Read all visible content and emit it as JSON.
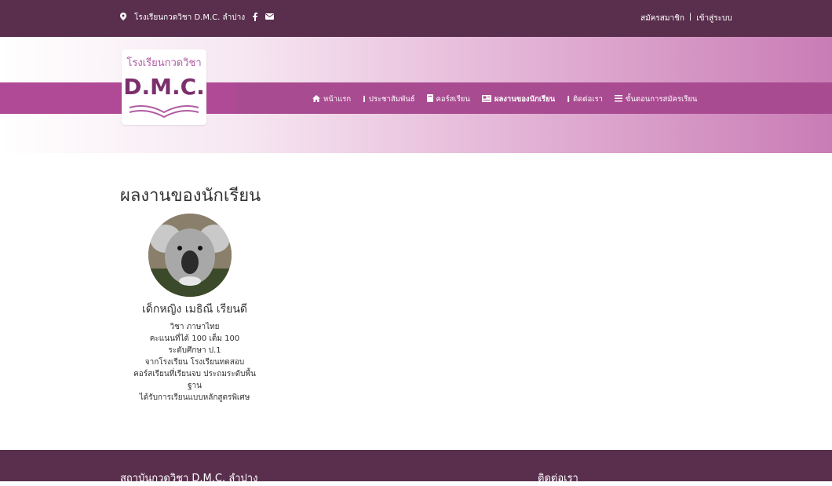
{
  "topbar": {
    "school_name": "โรงเรียนกวดวิชา D.M.C. ลำปาง",
    "register": "สมัครสมาชิก",
    "separator": "|",
    "login": "เข้าสู่ระบบ"
  },
  "logo": {
    "thai": "โรงเรียนกวดวิชา",
    "brand": "D.M.C."
  },
  "nav": [
    {
      "label": "หน้าแรก"
    },
    {
      "label": "ประชาสัมพันธ์"
    },
    {
      "label": "คอร์สเรียน"
    },
    {
      "label": "ผลงานของนักเรียน"
    },
    {
      "label": "ติดต่อเรา"
    },
    {
      "label": "ขั้นตอนการสมัครเรียน"
    }
  ],
  "main": {
    "title": "ผลงานของนักเรียน",
    "student": {
      "name": "เด็กหญิง เมธิณี เรียนดี",
      "subject": "วิชา ภาษาไทย",
      "score": "คะแนนที่ได้ 100 เต็ม 100",
      "level": "ระดับศึกษา ป.1",
      "school": "จากโรงเรียน โรงเรียนทดสอบ",
      "course_line1": "คอร์สเรียนที่เรียนจบ ประถมระดับพื้น",
      "course_line2": "ฐาน",
      "reward": "ได้รับการเรียนแบบหลักสูตรพิเศษ"
    }
  },
  "footer": {
    "institute": "สถาบันกวดวิชา D.M.C. ลำปาง",
    "contact": "ติดต่อเรา"
  }
}
